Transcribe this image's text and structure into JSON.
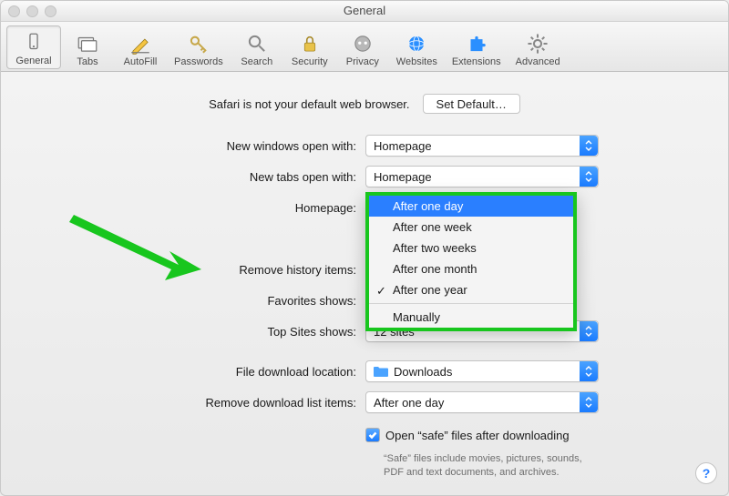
{
  "window": {
    "title": "General"
  },
  "toolbar": [
    {
      "id": "general",
      "label": "General"
    },
    {
      "id": "tabs",
      "label": "Tabs"
    },
    {
      "id": "autofill",
      "label": "AutoFill"
    },
    {
      "id": "passwords",
      "label": "Passwords"
    },
    {
      "id": "search",
      "label": "Search"
    },
    {
      "id": "security",
      "label": "Security"
    },
    {
      "id": "privacy",
      "label": "Privacy"
    },
    {
      "id": "websites",
      "label": "Websites"
    },
    {
      "id": "extensions",
      "label": "Extensions"
    },
    {
      "id": "advanced",
      "label": "Advanced"
    }
  ],
  "default_browser": {
    "message": "Safari is not your default web browser.",
    "button": "Set Default…"
  },
  "fields": {
    "new_windows": {
      "label": "New windows open with:",
      "value": "Homepage"
    },
    "new_tabs": {
      "label": "New tabs open with:",
      "value": "Homepage"
    },
    "homepage": {
      "label": "Homepage:"
    },
    "remove_history": {
      "label": "Remove history items:"
    },
    "favorites": {
      "label": "Favorites shows:"
    },
    "top_sites": {
      "label": "Top Sites shows:",
      "value": "12 sites"
    },
    "download_location": {
      "label": "File download location:",
      "value": "Downloads"
    },
    "remove_downloads": {
      "label": "Remove download list items:",
      "value": "After one day"
    },
    "open_safe": {
      "label": "Open “safe” files after downloading",
      "checked": true
    },
    "open_safe_hint": "“Safe” files include movies, pictures, sounds, PDF and text documents, and archives."
  },
  "history_dropdown": {
    "options": [
      "After one day",
      "After one week",
      "After two weeks",
      "After one month",
      "After one year",
      "Manually"
    ],
    "highlighted": "After one day",
    "checked": "After one year"
  },
  "help_button": "?"
}
